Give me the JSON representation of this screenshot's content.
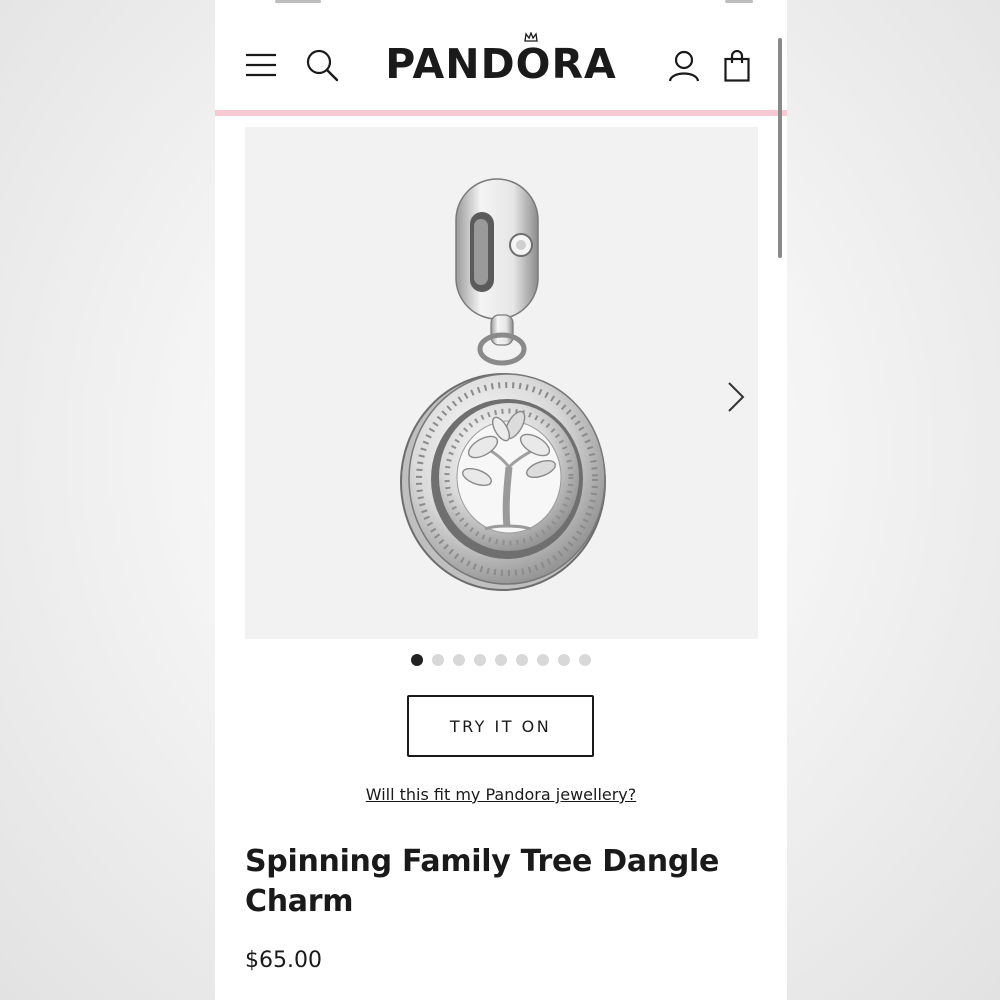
{
  "header": {
    "brand": "PANDORA",
    "icons": [
      "menu-icon",
      "search-icon",
      "account-icon",
      "bag-icon"
    ]
  },
  "gallery": {
    "image": "Spinning Family Tree Dangle Charm product photo",
    "total_images": 9,
    "active_index": 0
  },
  "actions": {
    "try_on_label": "TRY IT ON",
    "fit_link_label": "Will this fit my Pandora jewellery?"
  },
  "product": {
    "title": "Spinning Family Tree Dangle Charm",
    "price": "$65.00"
  },
  "colors": {
    "accent_pink": "#f7c9d3",
    "text": "#1a1a1a"
  }
}
